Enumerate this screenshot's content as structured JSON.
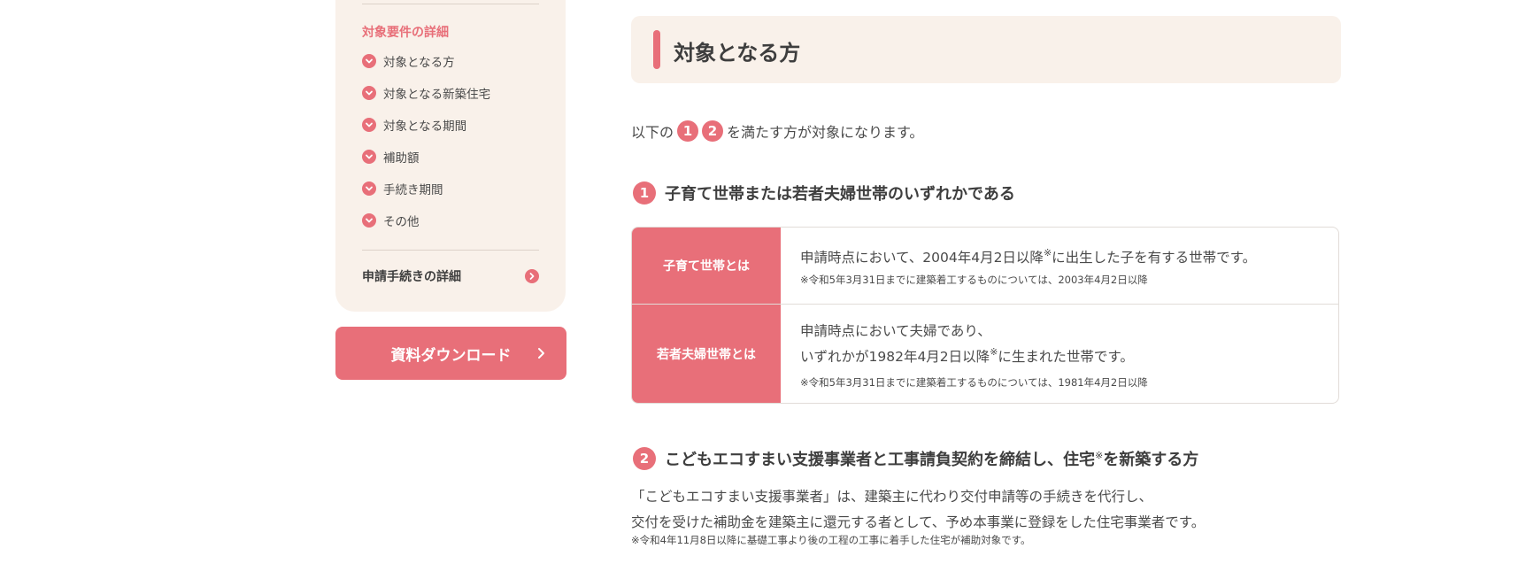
{
  "colors": {
    "accent": "#e86f79",
    "panel": "#f9f1ea",
    "text": "#4a4a4a"
  },
  "sidebar": {
    "heading": "対象要件の詳細",
    "items": [
      {
        "label": "対象となる方",
        "icon": "chevron-down-icon"
      },
      {
        "label": "対象となる新築住宅",
        "icon": "chevron-down-icon"
      },
      {
        "label": "対象となる期間",
        "icon": "chevron-down-icon"
      },
      {
        "label": "補助額",
        "icon": "chevron-down-icon"
      },
      {
        "label": "手続き期間",
        "icon": "chevron-down-icon"
      },
      {
        "label": "その他",
        "icon": "chevron-down-icon"
      }
    ],
    "apply_link": {
      "label": "申請手続きの詳細",
      "icon": "chevron-right-icon"
    },
    "download_button": {
      "label": "資料ダウンロード",
      "icon": "chevron-right-icon"
    }
  },
  "main": {
    "title": "対象となる方",
    "intro": {
      "prefix": "以下の",
      "badge1": "1",
      "badge2": "2",
      "suffix": "を満たす方が対象になります。"
    },
    "section1": {
      "number": "1",
      "heading": "子育て世帯または若者夫婦世帯のいずれかである",
      "rows": [
        {
          "label": "子育て世帯とは",
          "text_before": "申請時点において、2004年4月2日以降",
          "mark": "※",
          "text_after": "に出生した子を有する世帯です。",
          "note": "※令和5年3月31日までに建築着工するものについては、2003年4月2日以降"
        },
        {
          "label": "若者夫婦世帯とは",
          "line1": "申請時点において夫婦であり、",
          "text_before": "いずれかが1982年4月2日以降",
          "mark": "※",
          "text_after": "に生まれた世帯です。",
          "note": "※令和5年3月31日までに建築着工するものについては、1981年4月2日以降"
        }
      ]
    },
    "section2": {
      "number": "2",
      "heading_before": "こどもエコすまい支援事業者と工事請負契約を締結し、住宅",
      "mark": "※",
      "heading_after": "を新築する方",
      "para1": "「こどもエコすまい支援事業者」は、建築主に代わり交付申請等の手続きを代行し、",
      "para2": "交付を受けた補助金を建築主に還元する者として、予め本事業に登録をした住宅事業者です。",
      "note": "※令和4年11月8日以降に基礎工事より後の工程の工事に着手した住宅が補助対象です。"
    }
  }
}
